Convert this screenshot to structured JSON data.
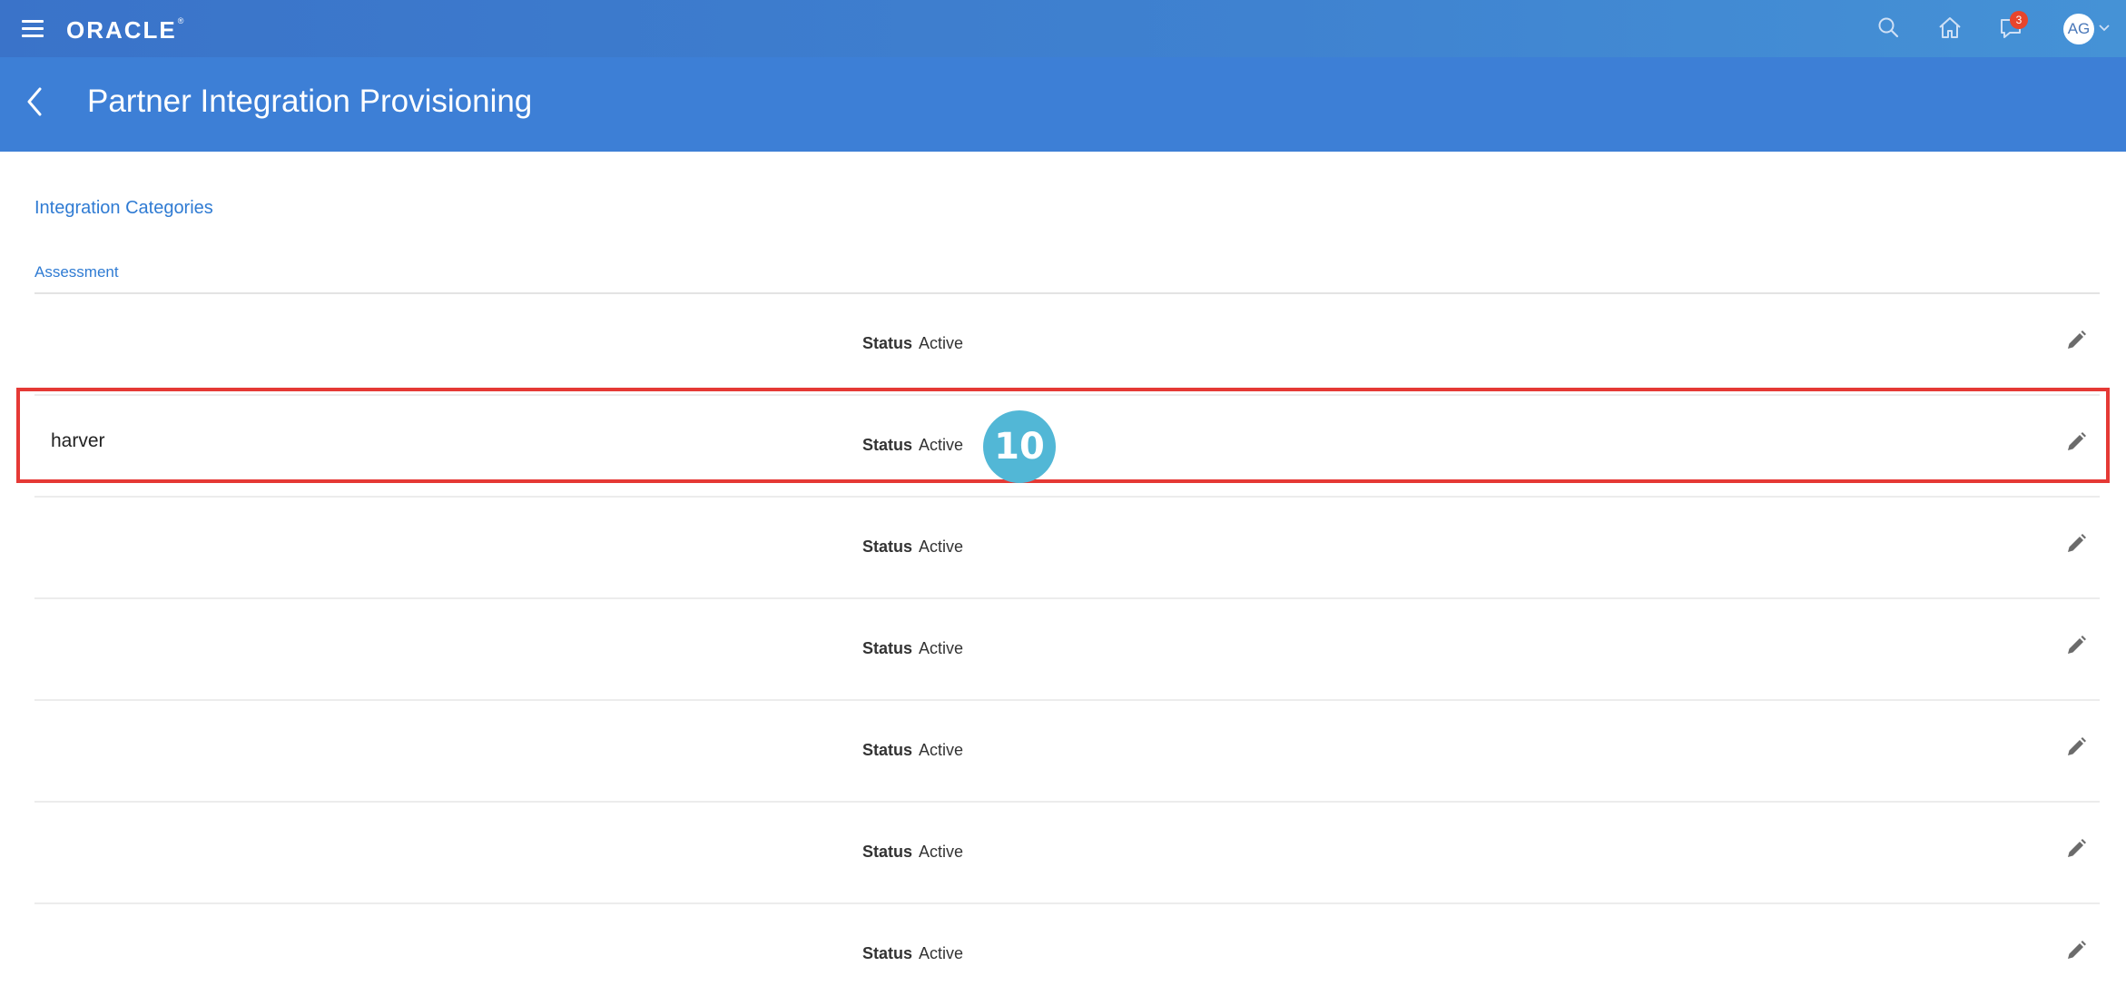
{
  "header": {
    "brand": "ORACLE",
    "brand_mark": "®",
    "notification_count": "3",
    "user_initials": "AG",
    "icons": [
      "menu-icon",
      "search-icon",
      "home-icon",
      "notifications-icon",
      "chevron-down-icon"
    ]
  },
  "page": {
    "title": "Partner Integration Provisioning"
  },
  "content": {
    "categories_link": "Integration Categories",
    "section_label": "Assessment",
    "rows": [
      {
        "name": "",
        "status_label": "Status",
        "status_value": "Active"
      },
      {
        "name": "harver",
        "status_label": "Status",
        "status_value": "Active"
      },
      {
        "name": "",
        "status_label": "Status",
        "status_value": "Active"
      },
      {
        "name": "",
        "status_label": "Status",
        "status_value": "Active"
      },
      {
        "name": "",
        "status_label": "Status",
        "status_value": "Active"
      },
      {
        "name": "",
        "status_label": "Status",
        "status_value": "Active"
      },
      {
        "name": "",
        "status_label": "Status",
        "status_value": "Active"
      }
    ]
  },
  "annotation": {
    "step_number": "10",
    "highlight_color": "#e53935",
    "badge_color": "#52b7d6"
  },
  "colors": {
    "header_bg": "#3d7fd6",
    "link": "#2f7bd3"
  }
}
